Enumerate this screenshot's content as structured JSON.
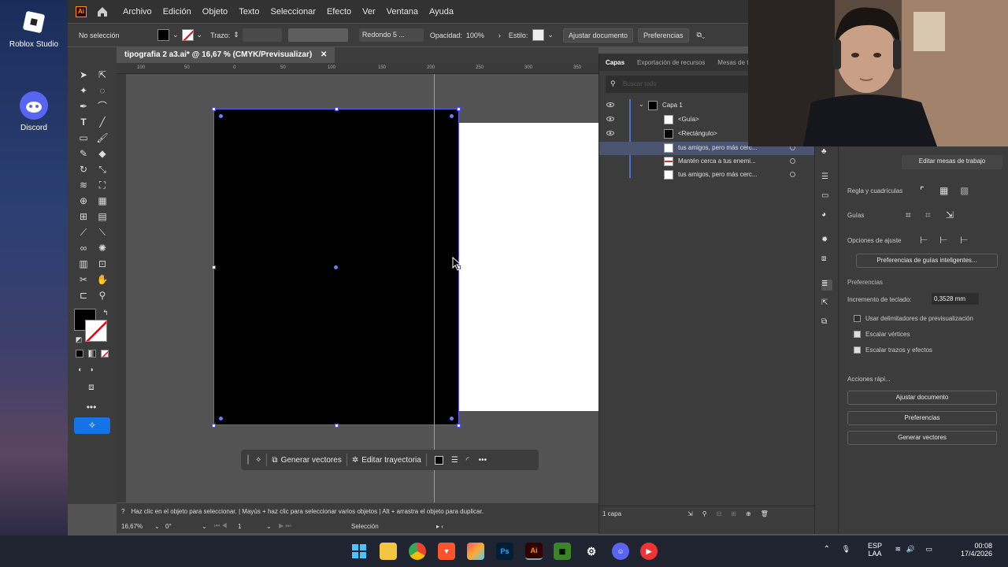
{
  "desktop": {
    "icons": [
      {
        "label": "Roblox Studio"
      },
      {
        "label": "Discord"
      }
    ]
  },
  "menubar": {
    "items": [
      "Archivo",
      "Edición",
      "Objeto",
      "Texto",
      "Seleccionar",
      "Efecto",
      "Ver",
      "Ventana",
      "Ayuda"
    ]
  },
  "control_bar": {
    "selection": "No selección",
    "stroke_label": "Trazo:",
    "brush": "Redondo 5 ...",
    "opacity_label": "Opacidad:",
    "opacity_value": "100%",
    "style_label": "Estilo:",
    "fit_doc_button": "Ajustar documento",
    "prefs_button": "Preferencias"
  },
  "document": {
    "tab_title": "tipografia 2 a3.ai* @ 16,67 % (CMYK/Previsualizar)",
    "ruler_marks": [
      "100",
      "50",
      "0",
      "50",
      "100",
      "150",
      "200",
      "250",
      "300",
      "350"
    ]
  },
  "context_toolbar": {
    "generate_vectors": "Generar vectores",
    "edit_path": "Editar trayectoria"
  },
  "hint_bar": {
    "text": "Haz clic en el objeto para seleccionar.  |  Mayús + haz clic para seleccionar varios objetos  |  Alt + arrastra el objeto para duplicar."
  },
  "status_bar": {
    "zoom": "16,67%",
    "rotation": "0°",
    "artboard_num": "1",
    "tool": "Selección"
  },
  "layers_panel": {
    "tabs": [
      "Capas",
      "Exportación de recursos",
      "Mesas de t"
    ],
    "search_placeholder": "Buscar todo",
    "layer_name": "Capa 1",
    "items": [
      "<Guía>",
      "<Rectángulo>",
      "tus amigos,  pero más cerc...",
      "Mantén cerca a  tus enemi...",
      "tus amigos,  pero más cerc..."
    ],
    "footer": "1 capa"
  },
  "properties_panel": {
    "edit_artboards": "Editar mesas de trabajo",
    "rulers_grids": "Regla y cuadrículas",
    "guides": "Guías",
    "snap_options": "Opciones de ajuste",
    "smart_guides_prefs": "Preferencias de guías inteligentes...",
    "preferences_header": "Preferencias",
    "keyboard_increment_label": "Incremento de teclado:",
    "keyboard_increment_value": "0,3528 mm",
    "use_preview_bounds": "Usar delimitadores de previsualización",
    "scale_corners": "Escalar vértices",
    "scale_strokes": "Escalar trazos y efectos",
    "quick_actions": "Acciones rápi...",
    "qa_fit_doc": "Ajustar documento",
    "qa_prefs": "Preferencias",
    "qa_generate": "Generar vectores"
  },
  "taskbar": {
    "apps": [
      "start",
      "explorer",
      "chrome",
      "brave",
      "photos",
      "Ps",
      "Ai",
      "minecraft",
      "chatgpt",
      "discord",
      "video"
    ],
    "lang_top": "ESP",
    "lang_bottom": "LAA",
    "time": "00:08",
    "date": "17/4/2026"
  },
  "colors": {
    "accent_blue": "#1473e6",
    "guide_green": "#2fd4a4",
    "ai_orange": "#ff9a00"
  }
}
